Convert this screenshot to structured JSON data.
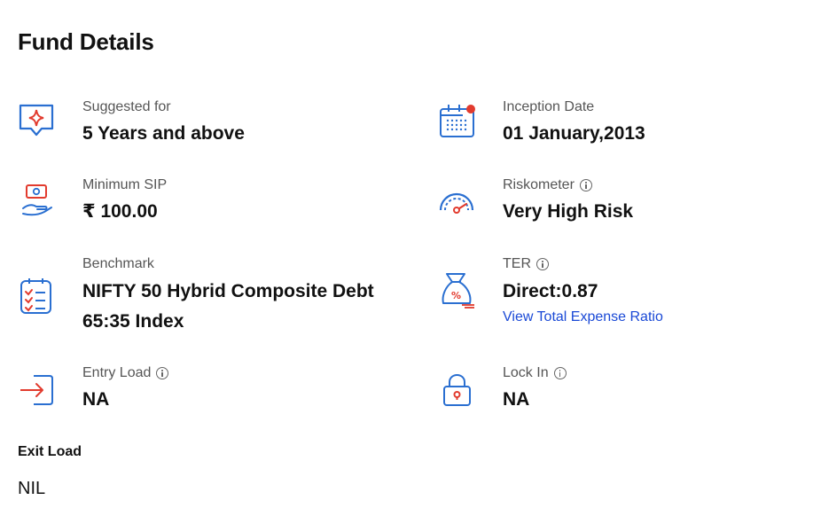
{
  "page": {
    "title": "Fund Details"
  },
  "details": {
    "suggested": {
      "label": "Suggested for",
      "value": "5 Years and above",
      "icon": "diamond-pin-icon"
    },
    "inception": {
      "label": "Inception Date",
      "value": "01 January,2013",
      "icon": "calendar-icon"
    },
    "min_sip": {
      "label": "Minimum SIP",
      "value": "₹ 100.00",
      "icon": "money-hand-icon"
    },
    "riskometer": {
      "label": "Riskometer",
      "value": "Very High Risk",
      "icon": "gauge-icon"
    },
    "benchmark": {
      "label": "Benchmark",
      "value_line1": "NIFTY 50 Hybrid Composite Debt",
      "value_line2": "65:35 Index",
      "icon": "checklist-icon"
    },
    "ter": {
      "label": "TER",
      "value": "Direct:0.87",
      "link": "View Total Expense Ratio",
      "icon": "money-bag-percent-icon"
    },
    "entry_load": {
      "label": "Entry Load",
      "value": "NA",
      "icon": "entry-arrow-icon"
    },
    "lock_in": {
      "label": "Lock In",
      "value": "NA",
      "icon": "lock-icon"
    }
  },
  "exit_load": {
    "label": "Exit Load",
    "value": "NIL"
  },
  "colors": {
    "icon_blue": "#2a6fd1",
    "icon_red": "#e23b2e",
    "link": "#1a49d6"
  }
}
